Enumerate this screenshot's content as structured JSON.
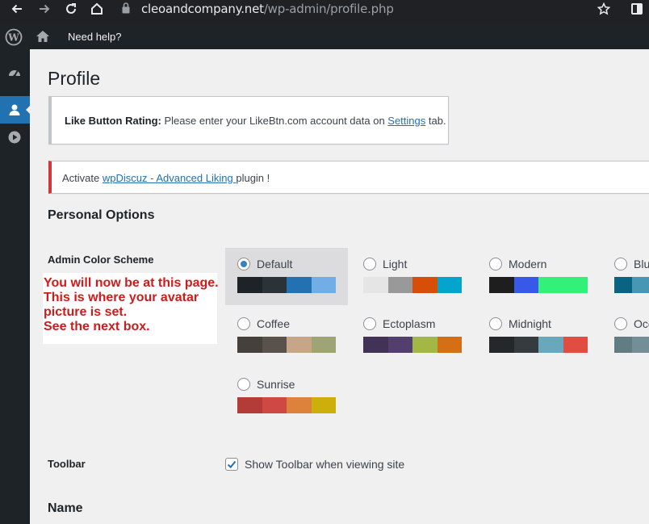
{
  "browser": {
    "url_host": "cleoandcompany.net",
    "url_path": "/wp-admin/profile.php"
  },
  "adminbar": {
    "help_label": "Need help?"
  },
  "page": {
    "title": "Profile"
  },
  "notices": {
    "likebtn": {
      "strong": "Like Button Rating:",
      "text_before": " Please enter your LikeBtn.com account data on ",
      "link": "Settings",
      "text_after": " tab."
    },
    "wpdiscuz": {
      "text_before": "Activate ",
      "link": "wpDiscuz - Advanced Liking ",
      "text_after": "plugin !"
    }
  },
  "personal_options": {
    "heading": "Personal Options",
    "color_scheme_label": "Admin Color Scheme",
    "schemes": [
      {
        "name": "Default",
        "selected": true,
        "colors": [
          "#1d2327",
          "#2c3338",
          "#2271b1",
          "#72aee6"
        ]
      },
      {
        "name": "Light",
        "selected": false,
        "colors": [
          "#e5e5e5",
          "#999999",
          "#d64e07",
          "#04a4cc"
        ]
      },
      {
        "name": "Modern",
        "selected": false,
        "colors": [
          "#1e1e1e",
          "#3858e9",
          "#33f078",
          "#33f078"
        ]
      },
      {
        "name": "Blu",
        "selected": false,
        "colors": [
          "#096484",
          "#4796b3"
        ]
      },
      {
        "name": "Coffee",
        "selected": false,
        "colors": [
          "#46403c",
          "#59524c",
          "#c7a589",
          "#9ea476"
        ]
      },
      {
        "name": "Ectoplasm",
        "selected": false,
        "colors": [
          "#413256",
          "#523f6d",
          "#a3b745",
          "#d46f15"
        ]
      },
      {
        "name": "Midnight",
        "selected": false,
        "colors": [
          "#25282b",
          "#363b3f",
          "#69a8bb",
          "#e14d43"
        ]
      },
      {
        "name": "Oce",
        "selected": false,
        "colors": [
          "#627c83",
          "#738e96"
        ]
      },
      {
        "name": "Sunrise",
        "selected": false,
        "colors": [
          "#b43c38",
          "#cf4944",
          "#dd823b",
          "#ccaf0b"
        ]
      }
    ],
    "toolbar_label": "Toolbar",
    "toolbar_checkbox_label": "Show Toolbar when viewing site",
    "toolbar_checked": true
  },
  "name_section": {
    "heading": "Name"
  },
  "annotation": {
    "lines": [
      "You will now be at this page.",
      "This is where your avatar",
      "picture is set.",
      "See the next box."
    ]
  }
}
